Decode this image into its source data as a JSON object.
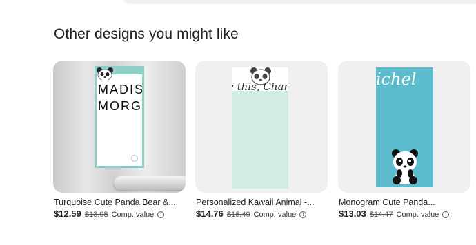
{
  "section": {
    "title": "Other designs you might like"
  },
  "products": [
    {
      "name": "Turquoise Cute Panda Bear &...",
      "price": "$12.59",
      "original_price": "$13.98",
      "comp_label": "Comp. value",
      "thumb_text": [
        "MADIS",
        "MORGA"
      ],
      "colors": {
        "pad": "#8ed0c8"
      }
    },
    {
      "name": "Personalized Kawaii Animal -...",
      "price": "$14.76",
      "original_price": "$16.40",
      "comp_label": "Comp. value",
      "thumb_text": "e this, Charl",
      "colors": {
        "pad": "#d3ece3"
      }
    },
    {
      "name": "Monogram Cute Panda...",
      "price": "$13.03",
      "original_price": "$14.47",
      "comp_label": "Comp. value",
      "thumb_text": "ichel",
      "colors": {
        "pad": "#5cbccd"
      }
    }
  ],
  "icons": {
    "info": "info-circle-icon",
    "panda": "panda-icon"
  }
}
